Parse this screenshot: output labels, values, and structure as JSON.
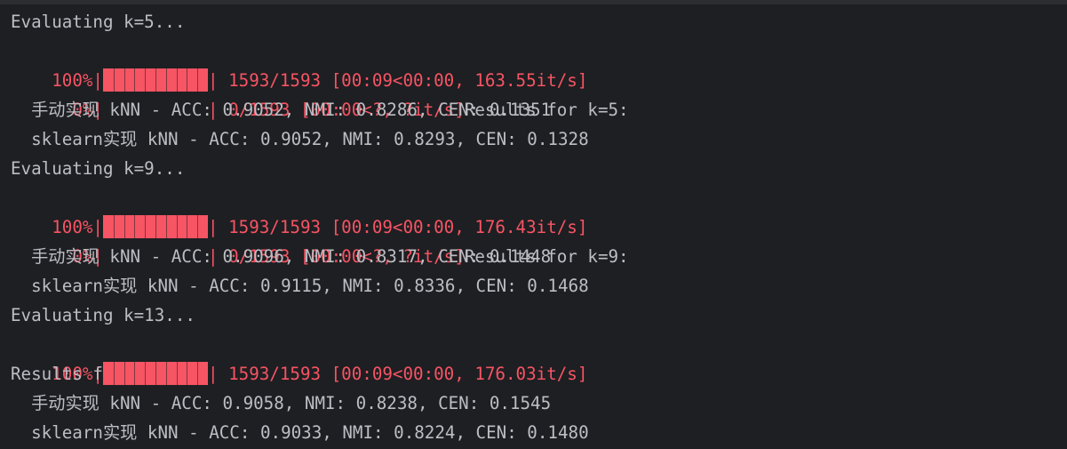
{
  "terminal": {
    "colors": {
      "background": "#1e1f22",
      "text": "#bcbec4",
      "stderr": "#f75464"
    },
    "blocks": [
      {
        "evaluating": "Evaluating k=5...",
        "bar_full": {
          "pct": "100%|",
          "progress": 1.0,
          "stats": "| 1593/1593 [00:09<00:00, 163.55it/s]"
        },
        "bar_empty": {
          "pct": "  0%|",
          "progress": 0.0,
          "stats": "| 0/1593 [00:00<?, ?it/s]"
        },
        "results": "Results for k=5:",
        "manual": "  手动实现 kNN - ACC: 0.9052, NMI: 0.8286, CEN: 0.1351",
        "sklearn": "  sklearn实现 kNN - ACC: 0.9052, NMI: 0.8293, CEN: 0.1328"
      },
      {
        "evaluating": "Evaluating k=9...",
        "bar_full": {
          "pct": "100%|",
          "progress": 1.0,
          "stats": "| 1593/1593 [00:09<00:00, 176.43it/s]"
        },
        "bar_empty": {
          "pct": "  0%|",
          "progress": 0.0,
          "stats": "| 0/1593 [00:00<?, ?it/s]"
        },
        "results": "Results for k=9:",
        "manual": "  手动实现 kNN - ACC: 0.9096, NMI: 0.8317, CEN: 0.1448",
        "sklearn": "  sklearn实现 kNN - ACC: 0.9115, NMI: 0.8336, CEN: 0.1468"
      },
      {
        "evaluating": "Evaluating k=13...",
        "bar_full": {
          "pct": "100%|",
          "progress": 1.0,
          "stats": "| 1593/1593 [00:09<00:00, 176.03it/s]"
        },
        "results": "Results for k=13:",
        "manual": "  手动实现 kNN - ACC: 0.9058, NMI: 0.8238, CEN: 0.1545",
        "sklearn": "  sklearn实现 kNN - ACC: 0.9033, NMI: 0.8224, CEN: 0.1480"
      }
    ]
  }
}
